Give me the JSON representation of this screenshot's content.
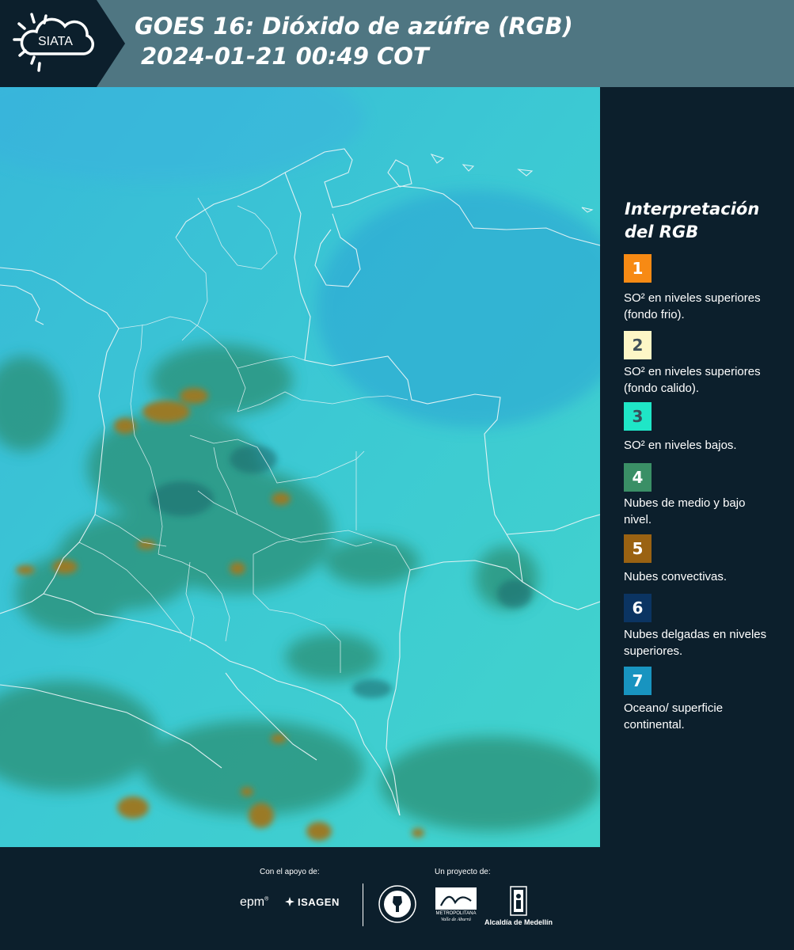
{
  "header": {
    "logo_text": "SIATA",
    "title_line1": "GOES 16: Dióxido de azúfre (RGB)",
    "title_line2": "2024-01-21 00:49 COT"
  },
  "legend": {
    "title_line1": "Interpretación",
    "title_line2": "del RGB",
    "items": [
      {
        "number": "1",
        "color": "#f78a14",
        "text_color": "#ffffff",
        "description": "SO² en niveles superiores (fondo frio)."
      },
      {
        "number": "2",
        "color": "#fdf6c6",
        "text_color": "#40505a",
        "description": "SO² en niveles superiores (fondo calido)."
      },
      {
        "number": "3",
        "color": "#1fe6c7",
        "text_color": "#38505a",
        "description": "SO² en niveles bajos."
      },
      {
        "number": "4",
        "color": "#3a8f66",
        "text_color": "#ffffff",
        "description": "Nubes de medio y bajo nivel."
      },
      {
        "number": "5",
        "color": "#9a6212",
        "text_color": "#ffffff",
        "description": "Nubes convectivas."
      },
      {
        "number": "6",
        "color": "#0b3462",
        "text_color": "#ffffff",
        "description": "Nubes delgadas en niveles superiores."
      },
      {
        "number": "7",
        "color": "#1894c0",
        "text_color": "#ffffff",
        "description": "Oceano/ superficie continental."
      }
    ]
  },
  "footer": {
    "support_label": "Con el apoyo de:",
    "project_label": "Un proyecto de:",
    "sponsors": [
      "epm",
      "ISAGEN"
    ],
    "partners": [
      "METROPOLITANA",
      "Valle de Aburrá",
      "Alcaldía de Medellín"
    ]
  },
  "map": {
    "colors": {
      "background": "#3bc8d6",
      "land_cloud": "#2e8f7a",
      "convective": "#9a7a28",
      "border": "#e8f4f6"
    }
  }
}
